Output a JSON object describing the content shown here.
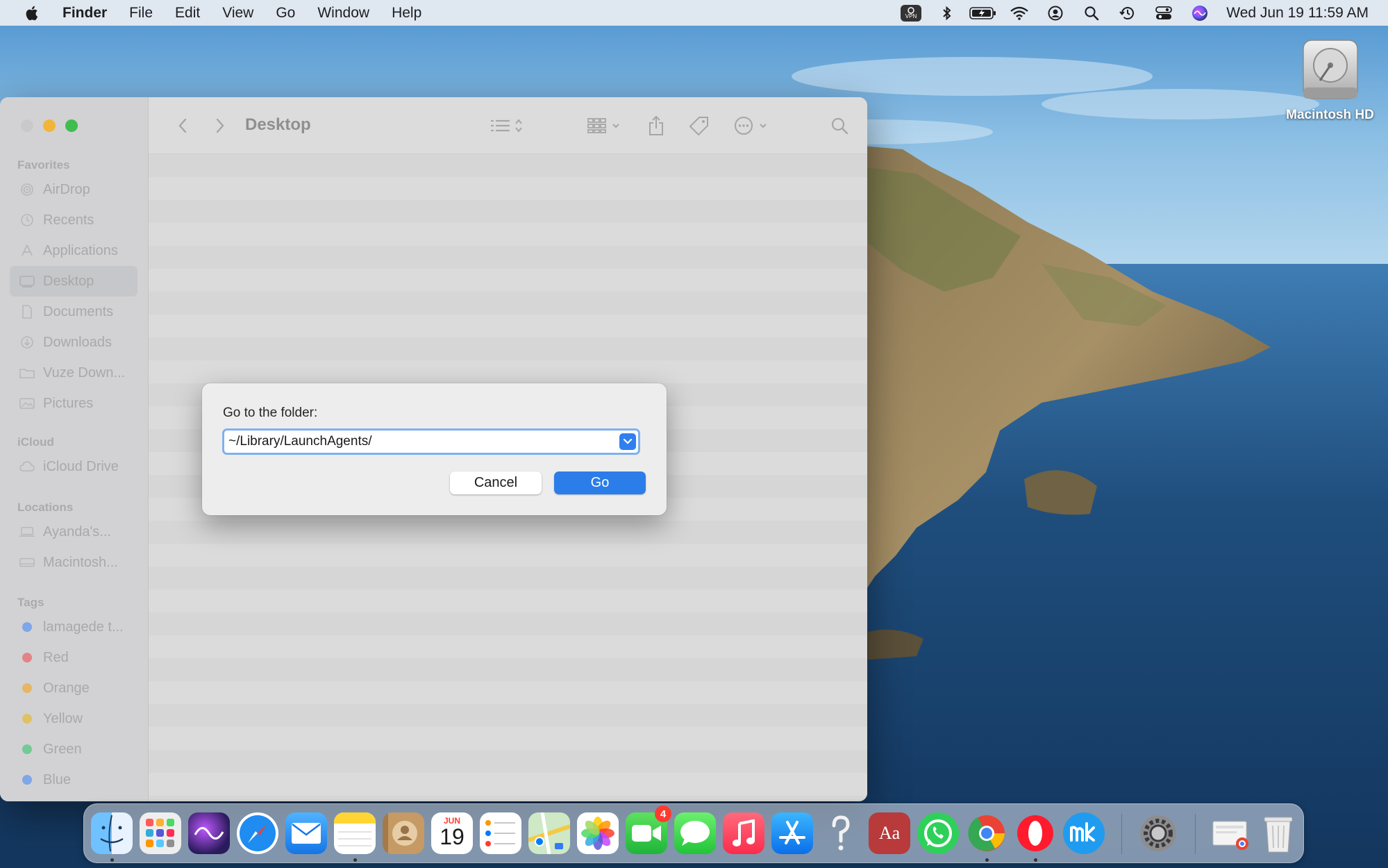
{
  "menubar": {
    "app_name": "Finder",
    "menus": [
      "File",
      "Edit",
      "View",
      "Go",
      "Window",
      "Help"
    ],
    "status_icons": [
      "vpn-icon",
      "bluetooth-icon",
      "battery-icon",
      "wifi-icon",
      "user-icon",
      "spotlight-icon",
      "time-machine-icon",
      "control-center-icon",
      "siri-icon"
    ],
    "vpn_text": "VPN",
    "clock": "Wed Jun 19  11:59 AM"
  },
  "desktop": {
    "hd_label": "Macintosh HD"
  },
  "finder": {
    "title": "Desktop",
    "sidebar": {
      "favorites_header": "Favorites",
      "favorites": [
        {
          "label": "AirDrop",
          "icon": "airdrop-icon"
        },
        {
          "label": "Recents",
          "icon": "clock-icon"
        },
        {
          "label": "Applications",
          "icon": "applications-icon"
        },
        {
          "label": "Desktop",
          "icon": "desktop-icon",
          "selected": true
        },
        {
          "label": "Documents",
          "icon": "document-icon"
        },
        {
          "label": "Downloads",
          "icon": "download-icon"
        },
        {
          "label": "Vuze Down...",
          "icon": "folder-icon"
        },
        {
          "label": "Pictures",
          "icon": "pictures-icon"
        }
      ],
      "icloud_header": "iCloud",
      "icloud": [
        {
          "label": "iCloud Drive",
          "icon": "cloud-icon"
        }
      ],
      "locations_header": "Locations",
      "locations": [
        {
          "label": "Ayanda's...",
          "icon": "laptop-icon"
        },
        {
          "label": "Macintosh...",
          "icon": "disk-icon"
        }
      ],
      "tags_header": "Tags",
      "tags": [
        {
          "label": "lamagede t...",
          "color": "#3b82f6"
        },
        {
          "label": "Red",
          "color": "#ef4444"
        },
        {
          "label": "Orange",
          "color": "#f59e0b"
        },
        {
          "label": "Yellow",
          "color": "#eab308"
        },
        {
          "label": "Green",
          "color": "#22c55e"
        },
        {
          "label": "Blue",
          "color": "#3b82f6"
        }
      ]
    }
  },
  "dialog": {
    "prompt": "Go to the folder:",
    "path_value": "~/Library/LaunchAgents/",
    "cancel_label": "Cancel",
    "go_label": "Go"
  },
  "dock": {
    "calendar_month": "JUN",
    "calendar_day": "19",
    "facetime_badge": "4",
    "dictionary_label": "Aa",
    "apps": [
      "finder",
      "launchpad",
      "siri",
      "safari",
      "mail",
      "notes",
      "contacts",
      "calendar",
      "reminders",
      "maps",
      "photos",
      "facetime",
      "messages",
      "music",
      "app-store",
      "help",
      "dictionary",
      "whatsapp",
      "chrome",
      "opera",
      "mk",
      "system-preferences",
      "chrome-downloads",
      "trash"
    ]
  },
  "colors": {
    "accent": "#2b7de9",
    "field_focus": "#7fb0f0"
  }
}
